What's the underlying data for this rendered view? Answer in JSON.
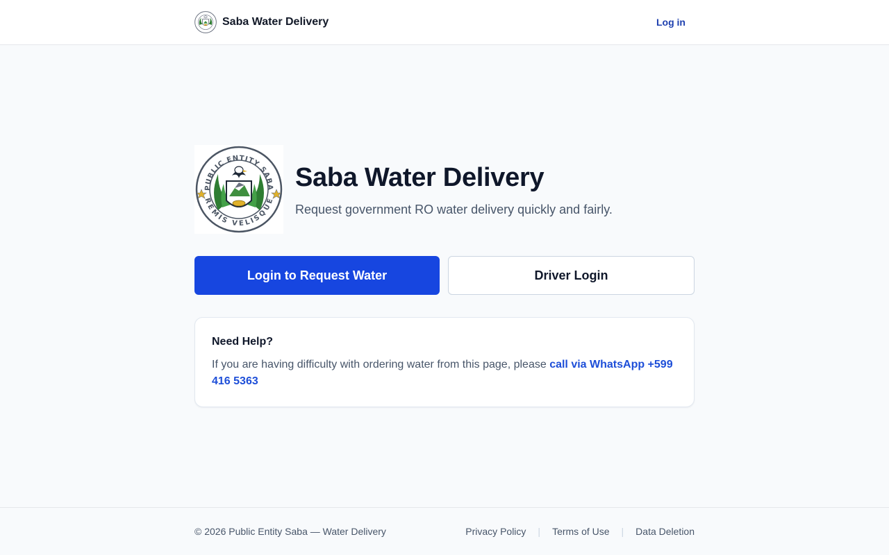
{
  "header": {
    "brand_name": "Saba Water Delivery",
    "logo_icon": "public-entity-saba-seal",
    "login_label": "Log in"
  },
  "hero": {
    "seal_top_text": "PUBLIC ENTITY SABA",
    "seal_bottom_text": "REMIS VELISQUE",
    "title": "Saba Water Delivery",
    "subtitle": "Request government RO water delivery quickly and fairly."
  },
  "actions": {
    "primary_label": "Login to Request Water",
    "secondary_label": "Driver Login"
  },
  "help": {
    "title": "Need Help?",
    "body_text": "If you are having difficulty with ordering water from this page, please ",
    "link_text": "call via WhatsApp +599 416 5363"
  },
  "footer": {
    "copyright": "© 2026 Public Entity Saba — Water Delivery",
    "links": [
      "Privacy Policy",
      "Terms of Use",
      "Data Deletion"
    ],
    "separator": "|"
  },
  "colors": {
    "primary": "#1746e0",
    "link": "#1d4ed8",
    "text_dark": "#0f172a",
    "text_muted": "#475569",
    "background": "#f8fafc"
  }
}
